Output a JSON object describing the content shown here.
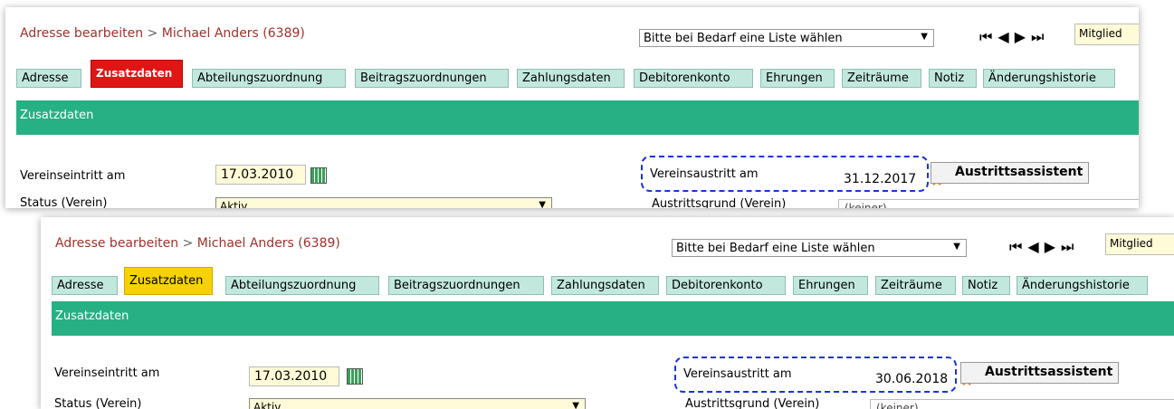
{
  "breadcrumb": {
    "prefix": "Adresse bearbeiten",
    "sep": " > ",
    "name": "Michael Anders (6389)"
  },
  "list_select": {
    "value": "Bitte bei Bedarf eine Liste wählen"
  },
  "nav_glyphs": "⏮◀▶⏭",
  "mitglied": "Mitglied",
  "tabs": [
    "Adresse",
    "Zusatzdaten",
    "Abteilungszuordnung",
    "Beitragszuordnungen",
    "Zahlungsdaten",
    "Debitorenkonto",
    "Ehrungen",
    "Zeiträume",
    "Notiz",
    "Änderungshistorie"
  ],
  "section_title": "Zusatzdaten",
  "form": {
    "eintritt_label": "Vereinseintritt am",
    "eintritt_value": "17.03.2010",
    "status_label": "Status (Verein)",
    "status_value": "Aktiv",
    "austritt_label": "Vereinsaustritt am",
    "grund_label": "Austrittsgrund (Verein)",
    "grund_value": "(keiner)",
    "assist_label": "Austrittsassistent"
  },
  "panels": [
    {
      "austritt_value": "31.12.2017",
      "active_tab_color": "#e01515"
    },
    {
      "austritt_value": "30.06.2018",
      "active_tab_color": "#f5d200"
    }
  ]
}
